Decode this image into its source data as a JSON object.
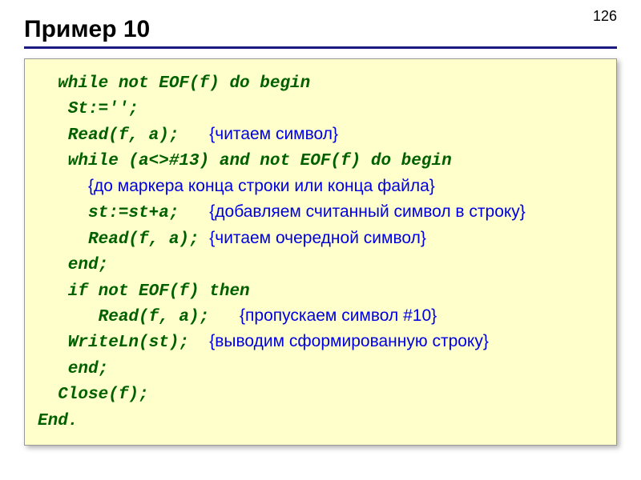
{
  "page_number": "126",
  "title": "Пример 10",
  "code": {
    "l1": "  while not EOF(f) do begin",
    "l2": "   St:='';",
    "l3a": "   Read(f, a);   ",
    "l3b": "{читаем символ}",
    "l4": "   while (a<>#13) and not EOF(f) do begin",
    "l5a": "     ",
    "l5b": "{до маркера конца строки или конца файла}",
    "l6a": "     st:=st+a;   ",
    "l6b": "{добавляем считанный символ в строку}",
    "l7a": "     Read(f, a); ",
    "l7b": "{читаем очередной символ}",
    "l8": "   end;",
    "l9": "   if not EOF(f) then",
    "l10a": "      Read(f, a);   ",
    "l10b": "{пропускаем символ #10}",
    "l11a": "   WriteLn(st);  ",
    "l11b": "{выводим сформированную строку}",
    "l12": "   end;",
    "l13": "  Close(f);",
    "l14": "End."
  }
}
